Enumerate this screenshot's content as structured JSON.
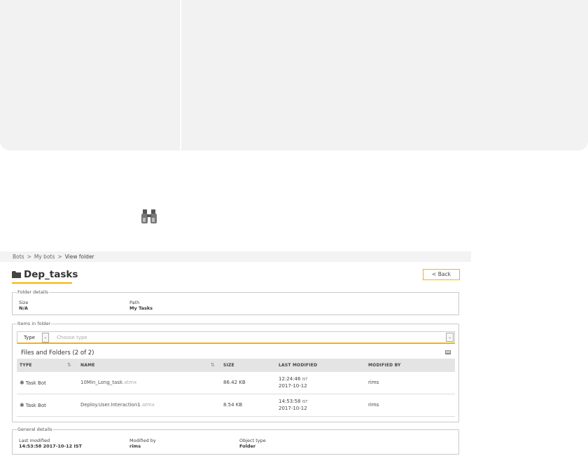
{
  "breadcrumb": {
    "items": [
      "Bots",
      "My bots"
    ],
    "current": "View folder",
    "separator": ">"
  },
  "page": {
    "title": "Dep_tasks",
    "back_label": "< Back"
  },
  "folder_details": {
    "legend": "Folder details",
    "size_label": "Size",
    "size_value": "N/A",
    "path_label": "Path",
    "path_value": "My Tasks"
  },
  "items_in_folder": {
    "legend": "Items in folder",
    "filter": {
      "type_label": "Type",
      "placeholder": "Choose type"
    },
    "count_label": "Files and Folders (2 of 2)",
    "columns": [
      "TYPE",
      "NAME",
      "SIZE",
      "LAST MODIFIED",
      "MODIFIED BY"
    ],
    "rows": [
      {
        "type": "Task Bot",
        "name": "10Min_Long_task",
        "ext": ".atmx",
        "size": "86.42 KB",
        "time": "12:24:46",
        "tz": "IST",
        "date": "2017-10-12",
        "modified_by": "rims"
      },
      {
        "type": "Task Bot",
        "name": "Deploy.User.Interaction1",
        "ext": ".atmx",
        "size": "8.54 KB",
        "time": "14:53:58",
        "tz": "IST",
        "date": "2017-10-12",
        "modified_by": "rims"
      }
    ]
  },
  "general_details": {
    "legend": "General details",
    "last_modified_label": "Last modified",
    "last_modified_value": "14:53:58 2017-10-12 IST",
    "modified_by_label": "Modified by",
    "modified_by_value": "rims",
    "object_type_label": "Object type",
    "object_type_value": "Folder"
  },
  "colors": {
    "accent": "#f5b400",
    "header_bg": "#e4e4e4",
    "panel_bg": "#f2f2f3"
  },
  "icons": [
    "binoculars-icon",
    "folder-icon",
    "chevron-down-icon",
    "grid-view-icon",
    "sort-icon",
    "task-bot-icon"
  ]
}
